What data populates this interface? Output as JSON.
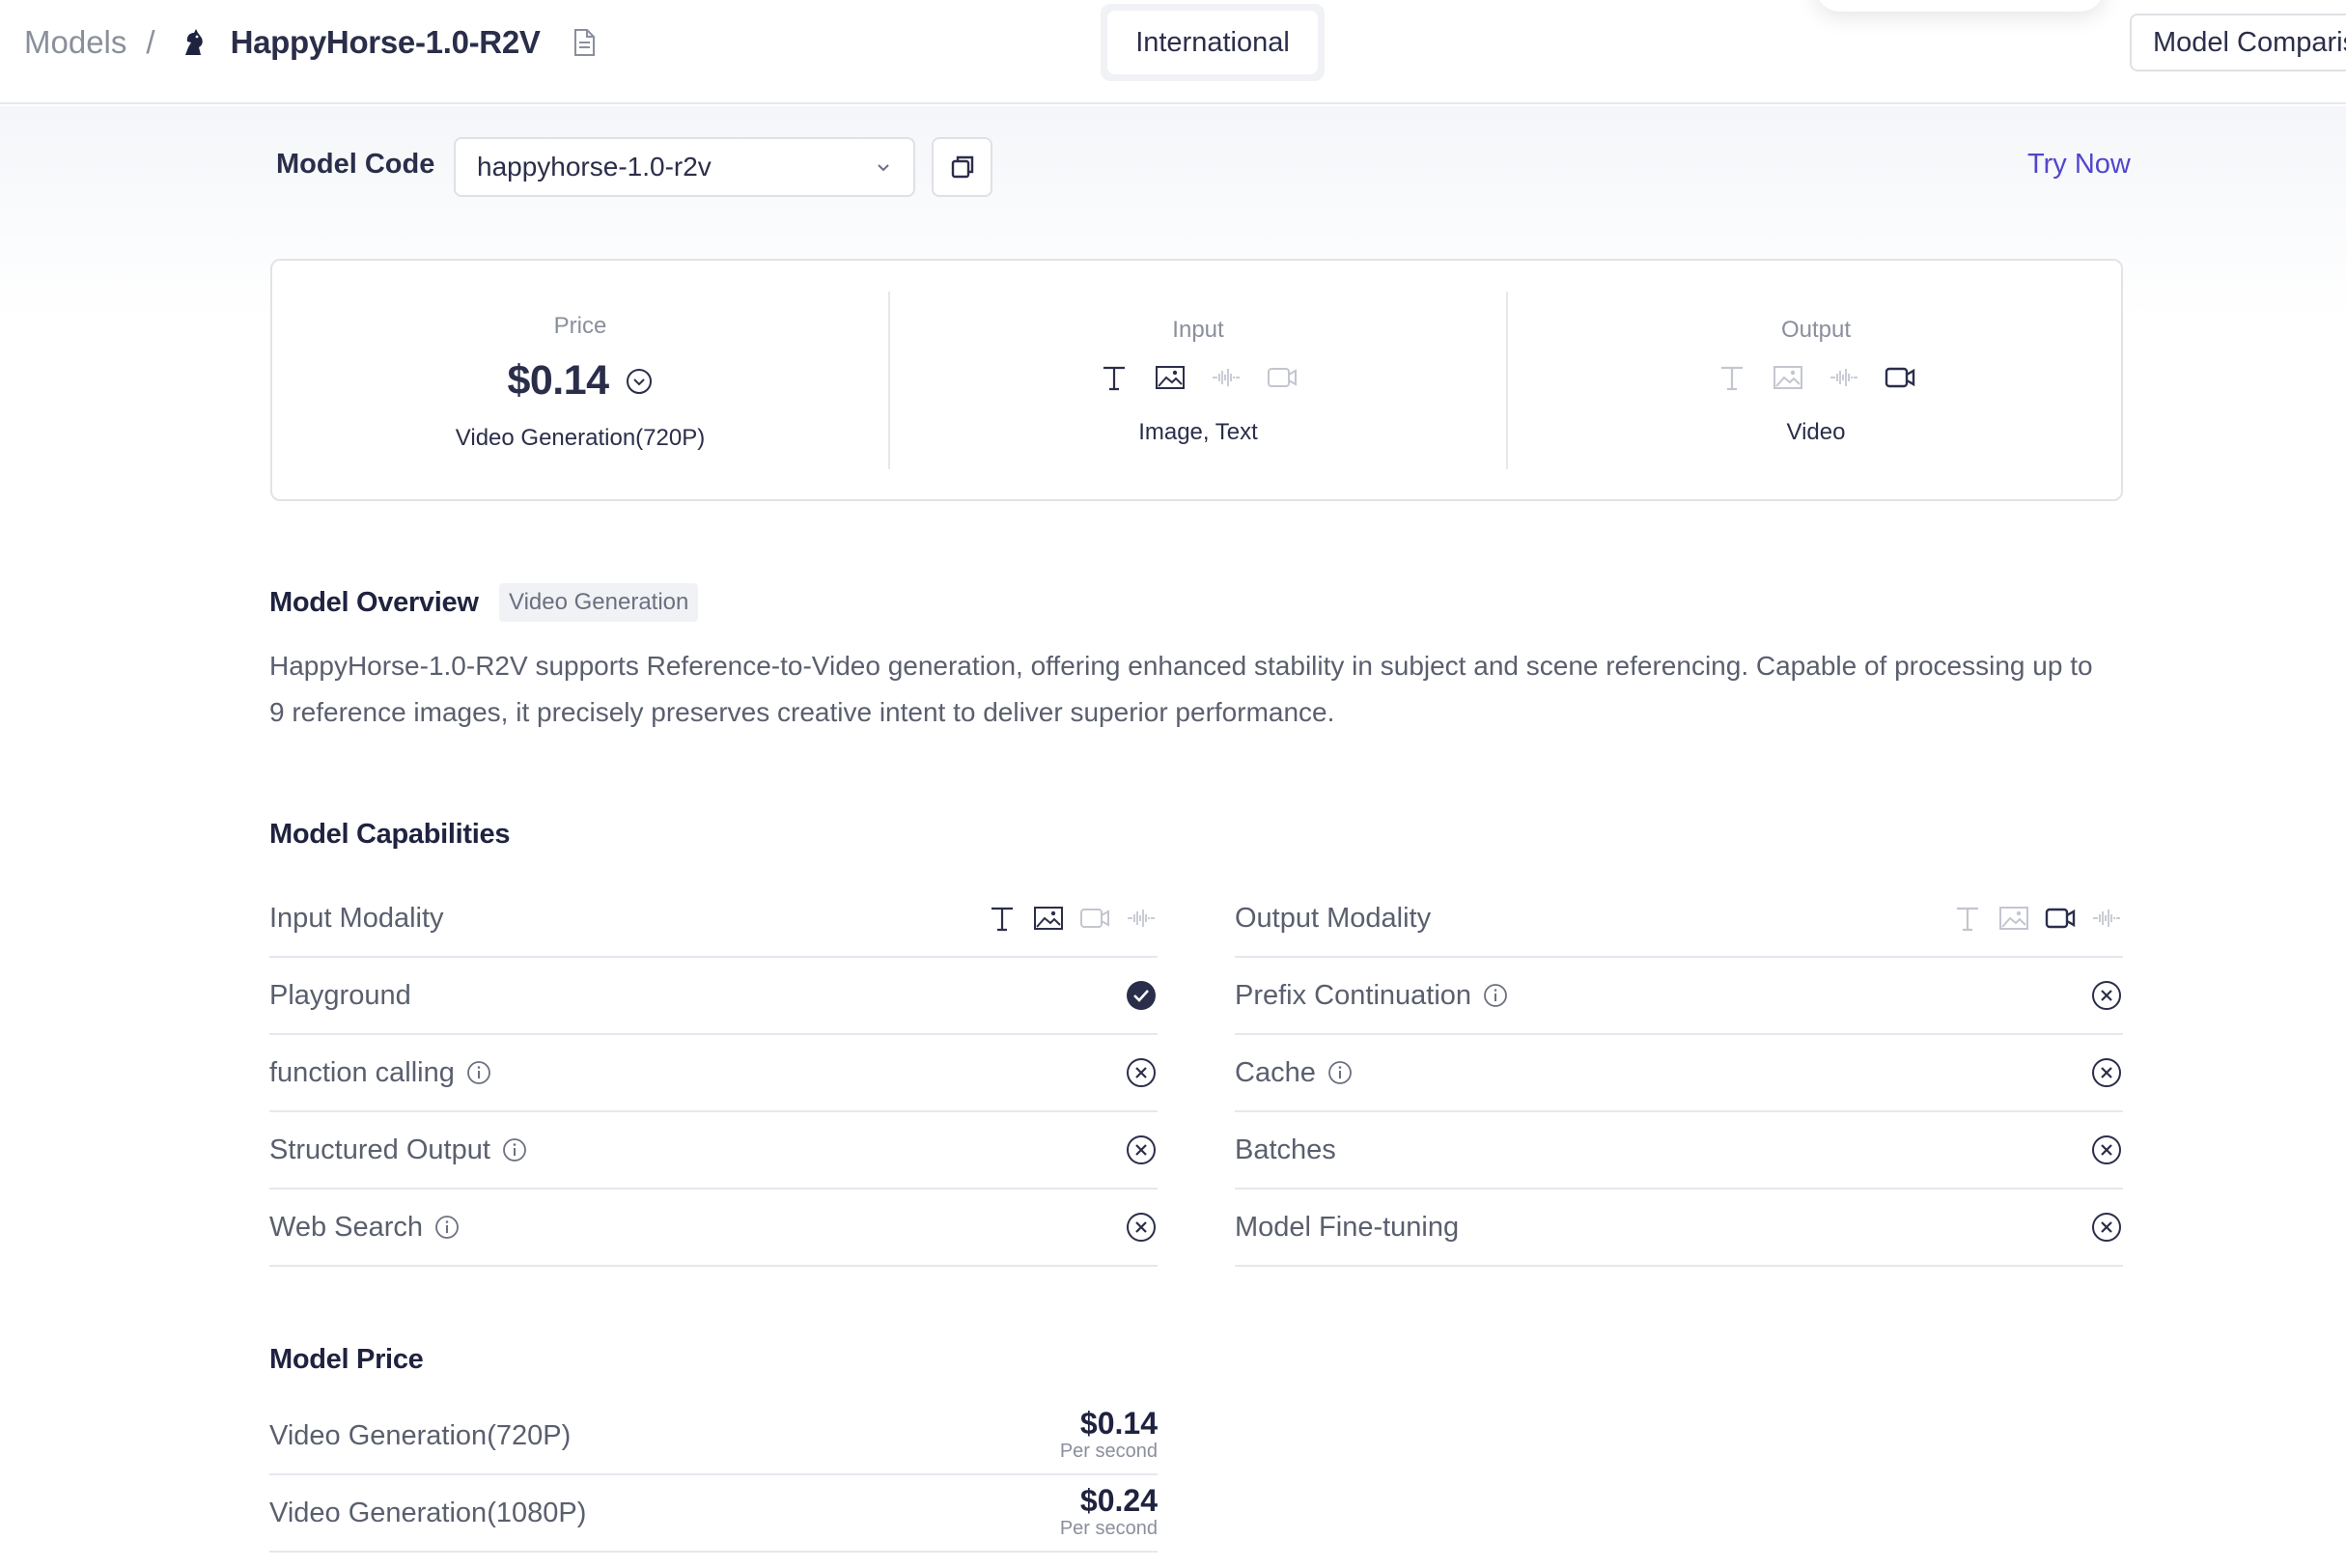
{
  "breadcrumb": {
    "models": "Models",
    "separator": "/",
    "title": "HappyHorse-1.0-R2V"
  },
  "header": {
    "region": "International",
    "compare": "Model Comparison"
  },
  "model_code": {
    "label": "Model Code",
    "value": "happyhorse-1.0-r2v"
  },
  "try_now": "Try Now",
  "summary": {
    "price_label": "Price",
    "price_value": "$0.14",
    "price_sub": "Video Generation(720P)",
    "input_label": "Input",
    "input_sub": "Image, Text",
    "output_label": "Output",
    "output_sub": "Video"
  },
  "overview": {
    "title": "Model Overview",
    "tag": "Video Generation",
    "text": "HappyHorse-1.0-R2V supports Reference-to-Video generation, offering enhanced stability in subject and scene referencing. Capable of processing up to 9 reference images, it precisely preserves creative intent to deliver superior performance."
  },
  "capabilities": {
    "title": "Model Capabilities",
    "left": [
      {
        "label": "Input Modality",
        "status": "modality"
      },
      {
        "label": "Playground",
        "status": "yes"
      },
      {
        "label": "function calling",
        "status": "no",
        "info": true
      },
      {
        "label": "Structured Output",
        "status": "no",
        "info": true
      },
      {
        "label": "Web Search",
        "status": "no",
        "info": true
      }
    ],
    "right": [
      {
        "label": "Output Modality",
        "status": "modality"
      },
      {
        "label": "Prefix Continuation",
        "status": "no",
        "info": true
      },
      {
        "label": "Cache",
        "status": "no",
        "info": true
      },
      {
        "label": "Batches",
        "status": "no"
      },
      {
        "label": "Model Fine-tuning",
        "status": "no"
      }
    ]
  },
  "pricing": {
    "title": "Model Price",
    "rows": [
      {
        "label": "Video Generation(720P)",
        "value": "$0.14",
        "unit": "Per second"
      },
      {
        "label": "Video Generation(1080P)",
        "value": "$0.24",
        "unit": "Per second"
      }
    ]
  },
  "colors": {
    "accent": "#5145cd",
    "text": "#2b2e4a",
    "muted": "#8a8f9c",
    "active_icon": "#2b2e4a",
    "inactive_icon": "#c3c6cf"
  }
}
